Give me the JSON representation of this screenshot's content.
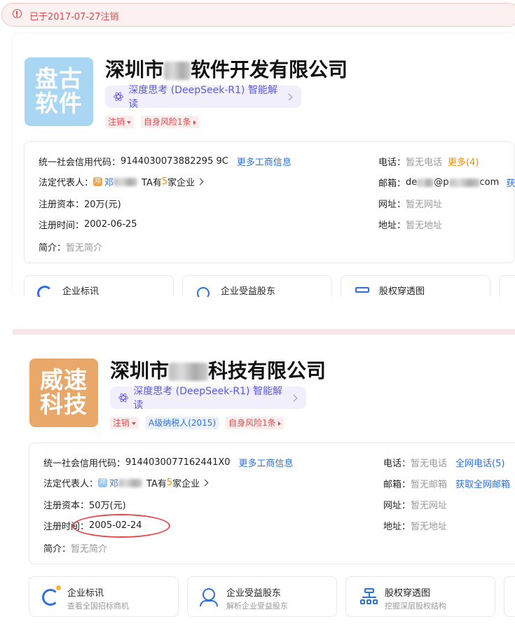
{
  "alert": {
    "text": "已于2017-07-27注销"
  },
  "companies": [
    {
      "logo": {
        "line1": "盘古",
        "line2": "软件",
        "bg": "#a9d6f2"
      },
      "title_prefix": "深圳市",
      "title_suffix": "软件开发有限公司",
      "ai": {
        "label": "深度思考 (DeepSeek-R1) 智能解读"
      },
      "tags": [
        "注销",
        "自身风险1条"
      ],
      "credit_label": "统一社会信用代码：",
      "credit_code": "9144030073882295 9C",
      "credit_value": "914403007388229 59C",
      "more_biz": "更多工商信息",
      "rep_label": "法定代表人：",
      "rep_avatar": "邓",
      "rep_name": "邓",
      "rep_ta": "TA有",
      "rep_count": "5",
      "rep_tail": "家企业",
      "capital_label": "注册资本：",
      "capital": "20万(元)",
      "date_label": "注册时间：",
      "date": "2002-06-25",
      "intro_label": "简介：",
      "intro": "暂无简介",
      "phone_label": "电话：",
      "phone": "暂无电话",
      "phone_more": "更多(4)",
      "email_label": "邮箱：",
      "email_a": "de",
      "email_b": "@p",
      "email_c": "com",
      "email_more": "获",
      "web_label": "网址：",
      "web": "暂无网址",
      "addr_label": "地址：",
      "addr": "暂无地址",
      "features": [
        "企业标讯",
        "企业受益股东",
        "股权穿透图"
      ]
    },
    {
      "logo": {
        "line1": "威速",
        "line2": "科技",
        "bg": "#e8a86a"
      },
      "title_prefix": "深圳市",
      "title_suffix": "科技有限公司",
      "ai": {
        "label": "深度思考 (DeepSeek-R1) 智能解读"
      },
      "tags": [
        "注销",
        "A级纳税人(2015)",
        "自身风险1条"
      ],
      "credit_label": "统一社会信用代码：",
      "credit_code": "9144030077162441X0",
      "more_biz": "更多工商信息",
      "rep_label": "法定代表人：",
      "rep_avatar": "邓",
      "rep_name": "邓",
      "rep_ta": "TA有",
      "rep_count": "5",
      "rep_tail": "家企业",
      "capital_label": "注册资本：",
      "capital": "50万(元)",
      "date_label": "注册时间：",
      "date": "2005-02-24",
      "intro_label": "简介：",
      "intro": "暂无简介",
      "phone_label": "电话：",
      "phone": "暂无电话",
      "phone_more": "全网电话(5)",
      "email_label": "邮箱：",
      "email": "暂无邮箱",
      "email_more": "获取全网邮箱",
      "web_label": "网址：",
      "web": "暂无网址",
      "addr_label": "地址：",
      "addr": "暂无地址",
      "features": [
        {
          "title": "企业标讯",
          "sub": "查看全国招标商机"
        },
        {
          "title": "企业受益股东",
          "sub": "解析企业受益股东"
        },
        {
          "title": "股权穿透图",
          "sub": "挖掘深层股权结构"
        }
      ]
    }
  ],
  "c1_credit": "9144030073882295 9C",
  "colors": {
    "red": "#e5484d",
    "blue": "#2f6fdb",
    "orange": "#f08c00",
    "purple": "#5b5bd6"
  }
}
